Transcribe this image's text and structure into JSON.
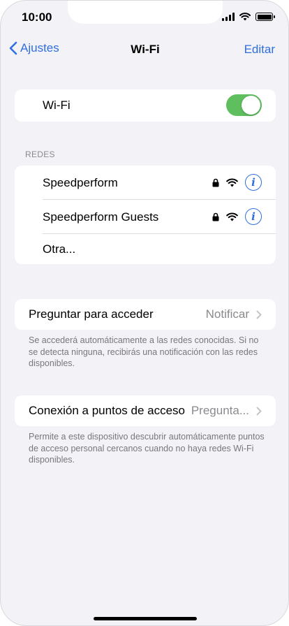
{
  "status_bar": {
    "time": "10:00"
  },
  "nav": {
    "back_label": "Ajustes",
    "title": "Wi-Fi",
    "edit_label": "Editar"
  },
  "wifi_toggle": {
    "label": "Wi-Fi",
    "on": true
  },
  "networks": {
    "header": "REDES",
    "items": [
      {
        "name": "Speedperform",
        "locked": true
      },
      {
        "name": "Speedperform Guests",
        "locked": true
      }
    ],
    "other_label": "Otra..."
  },
  "ask_to_join": {
    "label": "Preguntar para acceder",
    "value": "Notificar",
    "footnote": "Se accederá automáticamente a las redes conocidas. Si no se detecta ninguna, recibirás una notificación con las redes disponibles."
  },
  "hotspot": {
    "label": "Conexión a puntos de acceso",
    "value": "Pregunta...",
    "footnote": "Permite a este dispositivo descubrir automáticamente puntos de acceso personal cercanos cuando no haya redes Wi-Fi disponibles."
  },
  "colors": {
    "accent": "#2f6fe0",
    "toggle_on": "#5fbf5f",
    "background": "#f2f2f7"
  }
}
